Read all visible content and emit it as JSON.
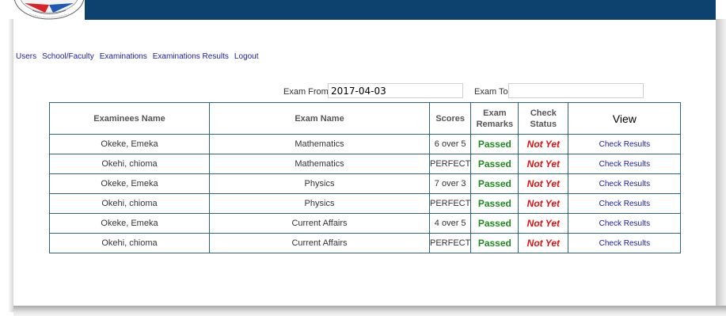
{
  "nav": {
    "items": [
      "Users",
      "School/Faculty",
      "Examinations",
      "Examinations Results",
      "Logout"
    ]
  },
  "filters": {
    "exam_from_label": "Exam From",
    "exam_from_value": "2017-04-03",
    "exam_to_label": "Exam To",
    "exam_to_value": ""
  },
  "table": {
    "headers": {
      "examinee": "Examinees Name",
      "exam_name": "Exam Name",
      "scores": "Scores",
      "remarks_1": "Exam",
      "remarks_2": "Remarks",
      "check_1": "Check",
      "check_2": "Status",
      "view": "View"
    },
    "rows": [
      {
        "name": "Okeke, Emeka",
        "exam": "Mathematics",
        "score": "6 over 5",
        "remark": "Passed",
        "status": "Not Yet",
        "link": "Check Results"
      },
      {
        "name": "Okehi, chioma",
        "exam": "Mathematics",
        "score": "PERFECT",
        "remark": "Passed",
        "status": "Not Yet",
        "link": "Check Results"
      },
      {
        "name": "Okeke, Emeka",
        "exam": "Physics",
        "score": "7 over 3",
        "remark": "Passed",
        "status": "Not Yet",
        "link": "Check Results"
      },
      {
        "name": "Okehi, chioma",
        "exam": "Physics",
        "score": "PERFECT",
        "remark": "Passed",
        "status": "Not Yet",
        "link": "Check Results"
      },
      {
        "name": "Okeke, Emeka",
        "exam": "Current Affairs",
        "score": "4 over 5",
        "remark": "Passed",
        "status": "Not Yet",
        "link": "Check Results"
      },
      {
        "name": "Okehi, chioma",
        "exam": "Current Affairs",
        "score": "PERFECT",
        "remark": "Passed",
        "status": "Not Yet",
        "link": "Check Results"
      }
    ]
  },
  "colors": {
    "header_bar": "#0d426e",
    "table_border": "#2a6680",
    "passed": "#1e8b1e",
    "not_yet": "#dd1111",
    "link": "#1a1aa6"
  },
  "icons": {
    "logo": "university-seal-logo"
  }
}
